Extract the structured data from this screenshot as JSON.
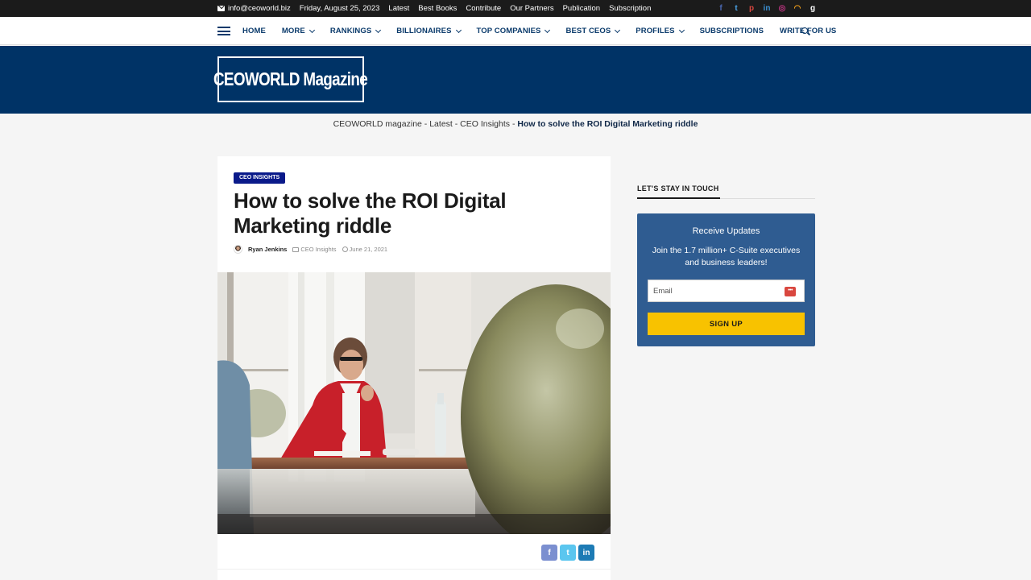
{
  "topbar": {
    "email": "info@ceoworld.biz",
    "date": "Friday, August 25, 2023",
    "links": [
      "Latest",
      "Best Books",
      "Contribute",
      "Our Partners",
      "Publication",
      "Subscription"
    ],
    "social": [
      {
        "icon": "facebook-icon",
        "glyph": "f",
        "color": "#4a67b1"
      },
      {
        "icon": "twitter-icon",
        "glyph": "t",
        "color": "#4aa3e6"
      },
      {
        "icon": "pinterest-icon",
        "glyph": "p",
        "color": "#d9473f"
      },
      {
        "icon": "linkedin-icon",
        "glyph": "in",
        "color": "#3b8fd1"
      },
      {
        "icon": "instagram-icon",
        "glyph": "◎",
        "color": "#c13584"
      },
      {
        "icon": "rss-icon",
        "glyph": "◠",
        "color": "#f29f1a"
      },
      {
        "icon": "google-icon",
        "glyph": "g",
        "color": "#ffffff"
      }
    ]
  },
  "nav": {
    "items": [
      {
        "label": "HOME",
        "dropdown": false
      },
      {
        "label": "MORE",
        "dropdown": true
      },
      {
        "label": "RANKINGS",
        "dropdown": true
      },
      {
        "label": "BILLIONAIRES",
        "dropdown": true
      },
      {
        "label": "TOP COMPANIES",
        "dropdown": true
      },
      {
        "label": "BEST CEOS",
        "dropdown": true
      },
      {
        "label": "PROFILES",
        "dropdown": true
      },
      {
        "label": "SUBSCRIPTIONS",
        "dropdown": false
      },
      {
        "label": "WRITE FOR US",
        "dropdown": false
      }
    ]
  },
  "banner": {
    "logo_text": "CEOWORLD Magazine",
    "background": "#003366"
  },
  "breadcrumb": {
    "items": [
      "CEOWORLD magazine",
      "Latest",
      "CEO Insights"
    ],
    "separator": " - ",
    "current": "How to solve the ROI Digital Marketing riddle"
  },
  "article": {
    "category": "CEO INSIGHTS",
    "title": "How to solve the ROI Digital Marketing riddle",
    "author": "Ryan Jenkins",
    "category_link": "CEO Insights",
    "date": "June 21, 2021",
    "share": [
      {
        "icon": "facebook-icon",
        "glyph": "f"
      },
      {
        "icon": "twitter-icon",
        "glyph": "t"
      },
      {
        "icon": "linkedin-icon",
        "glyph": "in"
      }
    ]
  },
  "sidebar": {
    "title": "LET'S STAY IN TOUCH",
    "signup": {
      "heading": "Receive Updates",
      "subtext": "Join the 1.7 million+ C-Suite executives and business leaders!",
      "email_placeholder": "Email",
      "button": "SIGN UP",
      "button_color": "#f8c200",
      "box_color": "#2f5c91"
    }
  }
}
